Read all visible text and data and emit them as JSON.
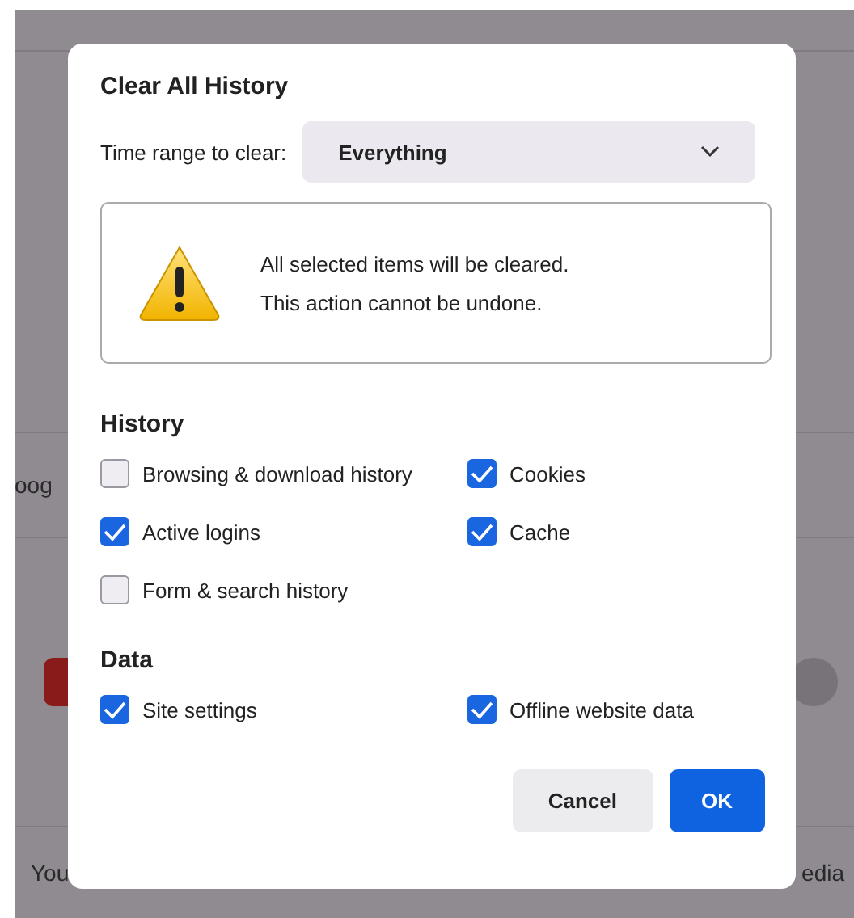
{
  "background": {
    "left_text": "oog",
    "bottom_left_text": "You",
    "bottom_right_text": "edia"
  },
  "dialog": {
    "title": "Clear All History",
    "time_range": {
      "label": "Time range to clear:",
      "value": "Everything"
    },
    "warning": [
      "All selected items will be cleared.",
      "This action cannot be undone."
    ],
    "sections": [
      {
        "heading": "History",
        "items": [
          {
            "label": "Browsing & download history",
            "checked": false
          },
          {
            "label": "Cookies",
            "checked": true
          },
          {
            "label": "Active logins",
            "checked": true
          },
          {
            "label": "Cache",
            "checked": true
          },
          {
            "label": "Form & search history",
            "checked": false
          }
        ]
      },
      {
        "heading": "Data",
        "items": [
          {
            "label": "Site settings",
            "checked": true
          },
          {
            "label": "Offline website data",
            "checked": true
          }
        ]
      }
    ],
    "buttons": [
      {
        "label": "Cancel",
        "kind": "secondary"
      },
      {
        "label": "OK",
        "kind": "primary"
      }
    ]
  }
}
